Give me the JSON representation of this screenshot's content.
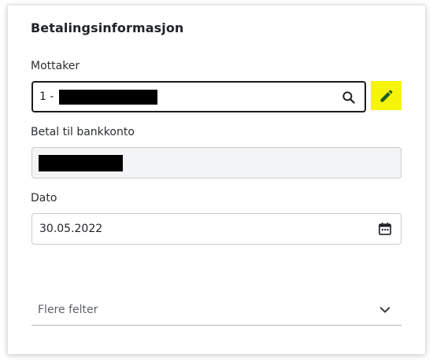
{
  "section": {
    "title": "Betalingsinformasjon"
  },
  "recipient": {
    "label": "Mottaker",
    "value_prefix": "1 -"
  },
  "edit_button": {
    "icon": "pencil-icon",
    "accent_color": "#f5f40a"
  },
  "account": {
    "label": "Betal til bankkonto"
  },
  "date": {
    "label": "Dato",
    "value": "30.05.2022"
  },
  "more_fields": {
    "label": "Flere felter"
  },
  "icons": {
    "search": "search-icon",
    "calendar": "calendar-icon",
    "expand": "chevron-down-icon"
  }
}
